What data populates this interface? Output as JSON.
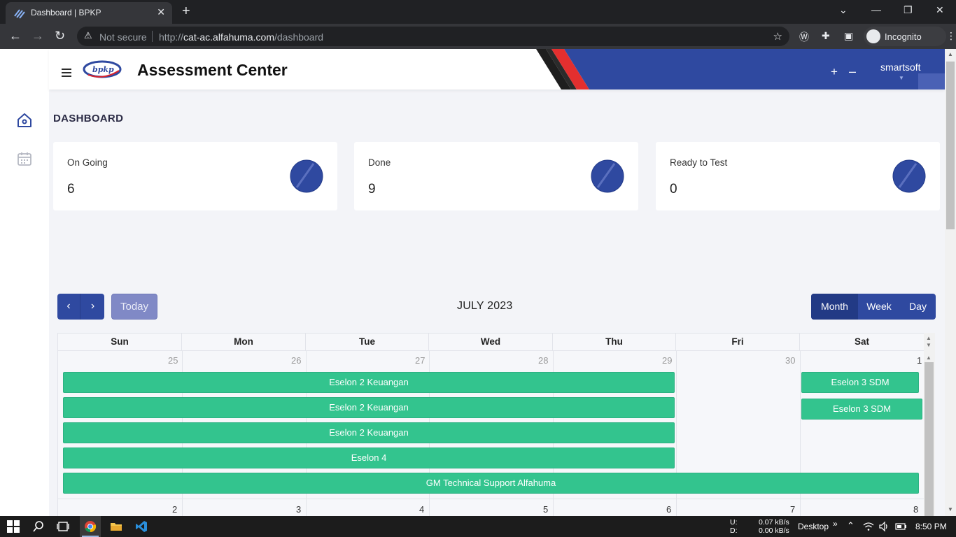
{
  "browser": {
    "tab_title": "Dashboard | BPKP",
    "security_label": "Not secure",
    "url_scheme": "http://",
    "url_host": "cat-ac.alfahuma.com",
    "url_path": "/dashboard",
    "profile_label": "Incognito"
  },
  "header": {
    "app_title": "Assessment Center",
    "logo_text": "bpkp",
    "plus_label": "+",
    "minus_label": "–",
    "username": "smartsoft",
    "brand_color": "#2f49a0"
  },
  "page": {
    "title": "DASHBOARD"
  },
  "stats": [
    {
      "label": "On Going",
      "value": "6"
    },
    {
      "label": "Done",
      "value": "9"
    },
    {
      "label": "Ready to Test",
      "value": "0"
    }
  ],
  "calendar": {
    "title": "JULY 2023",
    "today_label": "Today",
    "prev_icon": "‹",
    "next_icon": "›",
    "views": [
      "Month",
      "Week",
      "Day"
    ],
    "active_view": "Month",
    "day_headers": [
      "Sun",
      "Mon",
      "Tue",
      "Wed",
      "Thu",
      "Fri",
      "Sat"
    ],
    "week1_dates": [
      "25",
      "26",
      "27",
      "28",
      "29",
      "30",
      "1"
    ],
    "week2_dates": [
      "2",
      "3",
      "4",
      "5",
      "6",
      "7",
      "8"
    ],
    "event_color": "#33c48e",
    "events": [
      {
        "title": "Eselon 2 Keuangan",
        "start_day": "Sun",
        "end_day": "Thu"
      },
      {
        "title": "Eselon 2 Keuangan",
        "start_day": "Sun",
        "end_day": "Thu"
      },
      {
        "title": "Eselon 2 Keuangan",
        "start_day": "Sun",
        "end_day": "Thu"
      },
      {
        "title": "Eselon 4",
        "start_day": "Sun",
        "end_day": "Thu"
      },
      {
        "title": "GM Technical Support Alfahuma",
        "start_day": "Sun",
        "end_day": "Sat"
      },
      {
        "title": "Eselon 3 SDM",
        "start_day": "Sat",
        "end_day": "Sat"
      },
      {
        "title": "Eselon 3 SDM",
        "start_day": "Sat",
        "end_day": "Sat"
      }
    ]
  },
  "taskbar": {
    "net_up_label": "U:",
    "net_down_label": "D:",
    "net_up": "0.07 kB/s",
    "net_down": "0.00 kB/s",
    "desktop_label": "Desktop",
    "chevron": "»",
    "time": "8:50 PM"
  }
}
